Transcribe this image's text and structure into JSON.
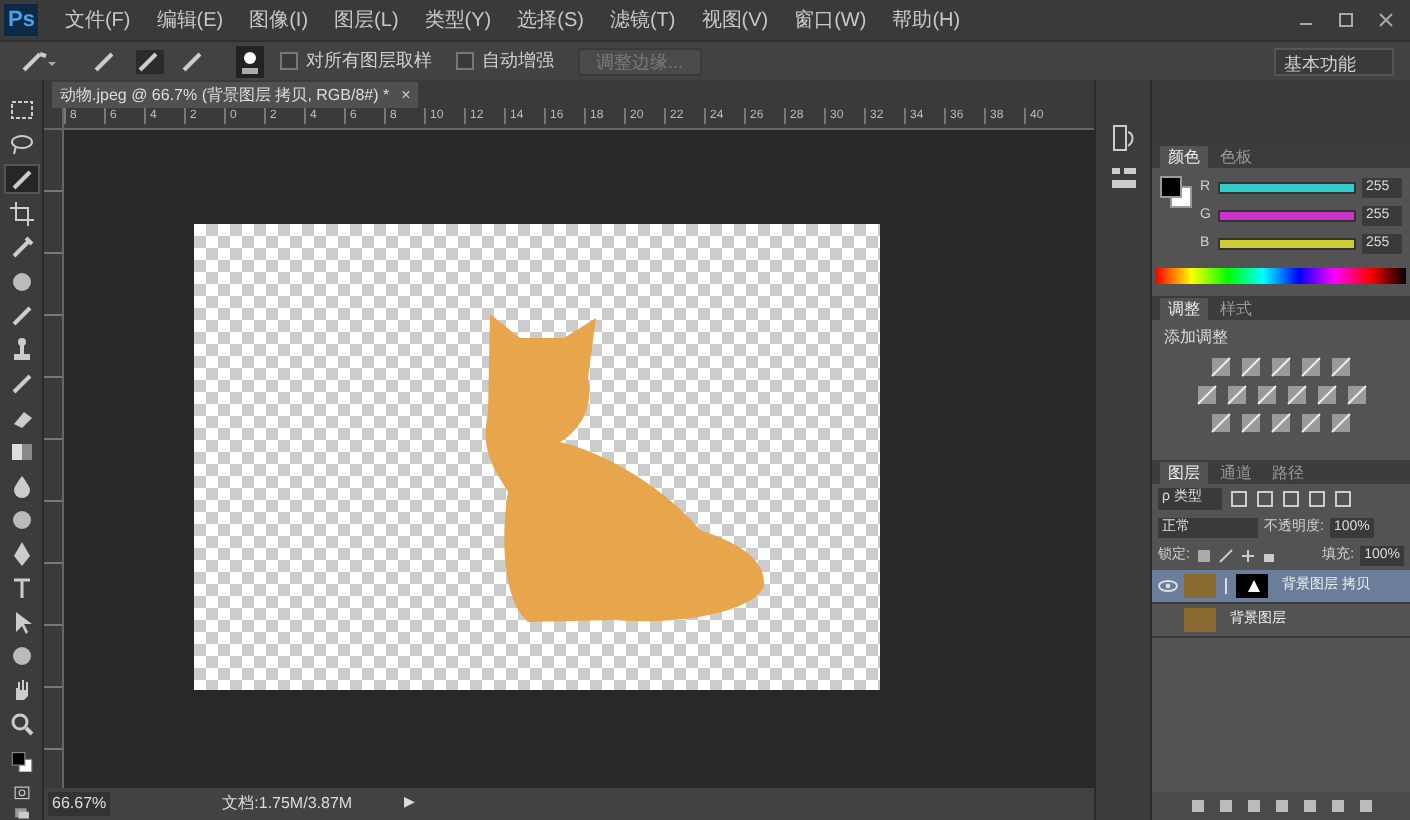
{
  "app": {
    "logo": "Ps"
  },
  "menu": [
    "文件(F)",
    "编辑(E)",
    "图像(I)",
    "图层(L)",
    "类型(Y)",
    "选择(S)",
    "滤镜(T)",
    "视图(V)",
    "窗口(W)",
    "帮助(H)"
  ],
  "options_bar": {
    "checkboxes": [
      {
        "label": "对所有图层取样",
        "checked": false
      },
      {
        "label": "自动增强",
        "checked": false
      }
    ],
    "refine_button": {
      "label": "调整边缘...",
      "disabled": true
    },
    "workspace": "基本功能"
  },
  "document_tab": {
    "title": "动物.jpeg @ 66.7% (背景图层 拷贝, RGB/8#) *",
    "close": "×"
  },
  "ruler": [
    "8",
    "6",
    "4",
    "2",
    "0",
    "2",
    "4",
    "6",
    "8",
    "10",
    "12",
    "14",
    "16",
    "18",
    "20",
    "22",
    "24",
    "26",
    "28",
    "30",
    "32",
    "34",
    "36",
    "38",
    "40"
  ],
  "tools": [
    {
      "kind": "marquee",
      "selected": false
    },
    {
      "kind": "lasso",
      "selected": false
    },
    {
      "kind": "brush",
      "selected": true
    },
    {
      "kind": "crop",
      "selected": false
    },
    {
      "kind": "dropper",
      "selected": false
    },
    {
      "kind": "circle",
      "selected": false
    },
    {
      "kind": "brush",
      "selected": false
    },
    {
      "kind": "stamp",
      "selected": false
    },
    {
      "kind": "brush",
      "selected": false
    },
    {
      "kind": "eraser",
      "selected": false
    },
    {
      "kind": "gradient",
      "selected": false
    },
    {
      "kind": "drop",
      "selected": false
    },
    {
      "kind": "circle",
      "selected": false
    },
    {
      "kind": "pen",
      "selected": false
    },
    {
      "kind": "type",
      "selected": false
    },
    {
      "kind": "arrow",
      "selected": false
    },
    {
      "kind": "circle",
      "selected": false
    },
    {
      "kind": "hand",
      "selected": false
    },
    {
      "kind": "zoom",
      "selected": false
    }
  ],
  "color_panel": {
    "tabs": [
      {
        "label": "颜色",
        "selected": true
      },
      {
        "label": "色板",
        "selected": false
      }
    ],
    "sliders": [
      {
        "label": "R",
        "value": "255",
        "level": 1,
        "color": "#33cccc"
      },
      {
        "label": "G",
        "value": "255",
        "level": 1,
        "color": "#cc33cc"
      },
      {
        "label": "B",
        "value": "255",
        "level": 1,
        "color": "#cccc33"
      }
    ]
  },
  "adjustments_panel": {
    "tabs": [
      {
        "label": "调整",
        "selected": true
      },
      {
        "label": "样式",
        "selected": false
      }
    ],
    "heading": "添加调整"
  },
  "layers_panel": {
    "tabs": [
      {
        "label": "图层",
        "selected": true
      },
      {
        "label": "通道",
        "selected": false
      },
      {
        "label": "路径",
        "selected": false
      }
    ],
    "filter": "ρ 类型",
    "blend_mode": "正常",
    "opacity_label": "不透明度:",
    "opacity": "100%",
    "lock_label": "锁定:",
    "fill_label": "填充:",
    "fill": "100%",
    "layers": [
      {
        "name": "背景图层 拷贝",
        "visible": true,
        "selected": true,
        "mask": true
      },
      {
        "name": "背景图层",
        "visible": false,
        "selected": false,
        "mask": false
      }
    ]
  },
  "status_bar": {
    "zoom": "66.67%",
    "doc": "文档:1.75M/3.87M",
    "arrow": "▶"
  }
}
